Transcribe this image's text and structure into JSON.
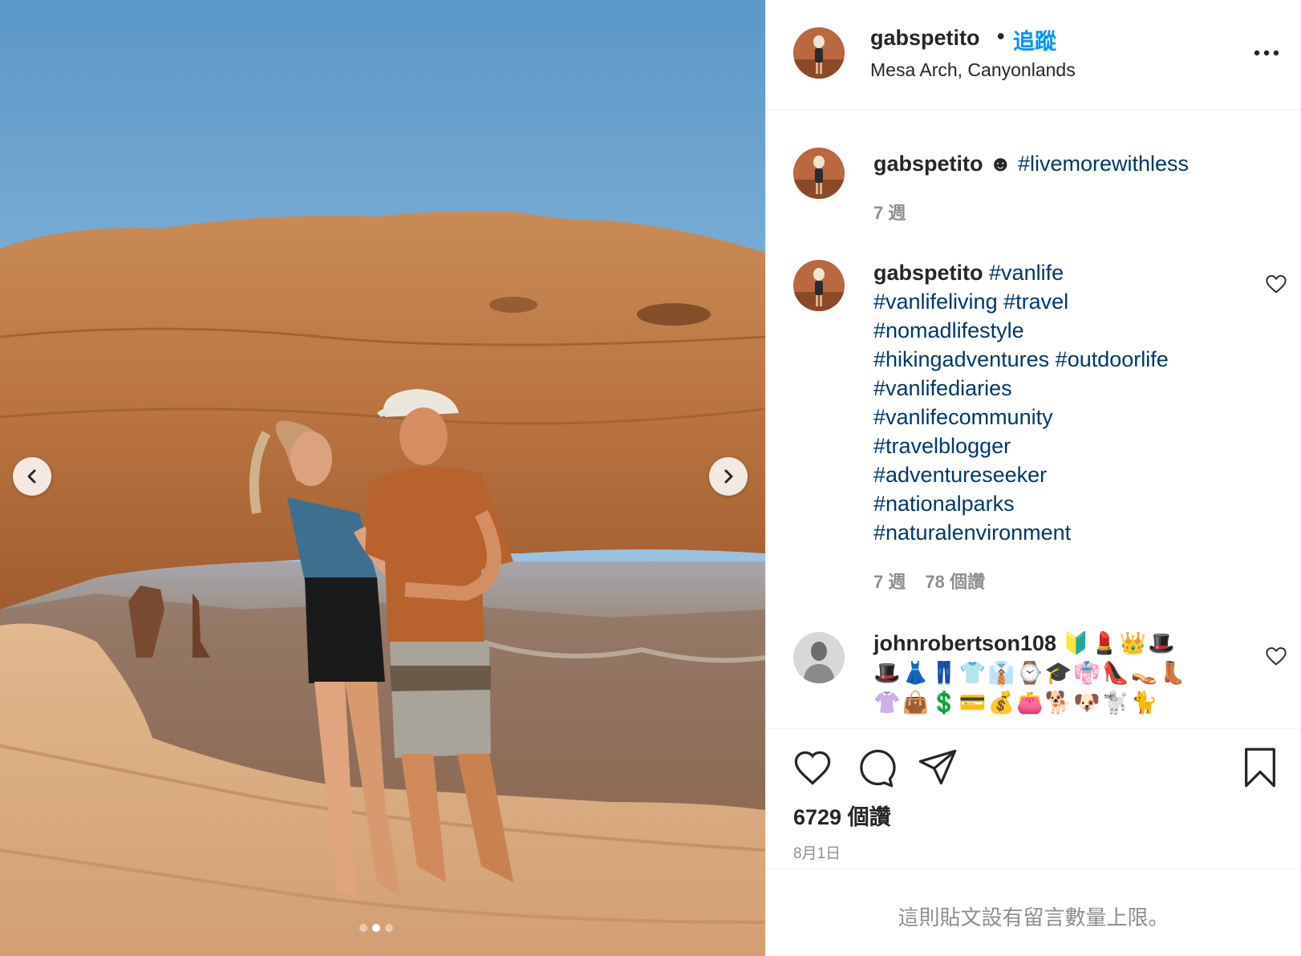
{
  "post": {
    "username": "gabspetito",
    "follow_label": "追蹤",
    "separator": "•",
    "location": "Mesa Arch, Canyonlands",
    "carousel": {
      "slide_count": 3,
      "active_index": 1
    }
  },
  "caption": {
    "username": "gabspetito",
    "emoji": "☻",
    "hashtag": "#livemorewithless",
    "time": "7 週"
  },
  "comments": [
    {
      "username": "gabspetito",
      "tags": [
        "#vanlife",
        "#vanlifeliving",
        "#travel",
        "#nomadlifestyle",
        "#hikingadventures",
        "#outdoorlife",
        "#vanlifediaries",
        "#vanlifecommunity",
        "#travelblogger",
        "#adventureseeker",
        "#nationalparks",
        "#naturalenvironment"
      ],
      "time": "7 週",
      "likes": "78 個讚"
    },
    {
      "username": "johnrobertson108",
      "emoji_line1": "🔰💄👑🎩",
      "emoji_line2": "🎩👗👖👕👔⌚🎓👘👠👡👢",
      "emoji_line3": "👚👜💲💳💰👛🐕🐶🐩🐈"
    }
  ],
  "actions": {
    "likes": "6729 個讚",
    "date": "8月1日"
  },
  "footer": {
    "comments_closed": "這則貼文設有留言數量上限。"
  },
  "colors": {
    "link": "#0095f6",
    "hashtag": "#00376b",
    "muted": "#8e8e8e",
    "text": "#262626"
  },
  "icons": [
    "chevron-left-icon",
    "chevron-right-icon",
    "more-icon",
    "heart-icon",
    "comment-icon",
    "share-icon",
    "bookmark-icon"
  ]
}
